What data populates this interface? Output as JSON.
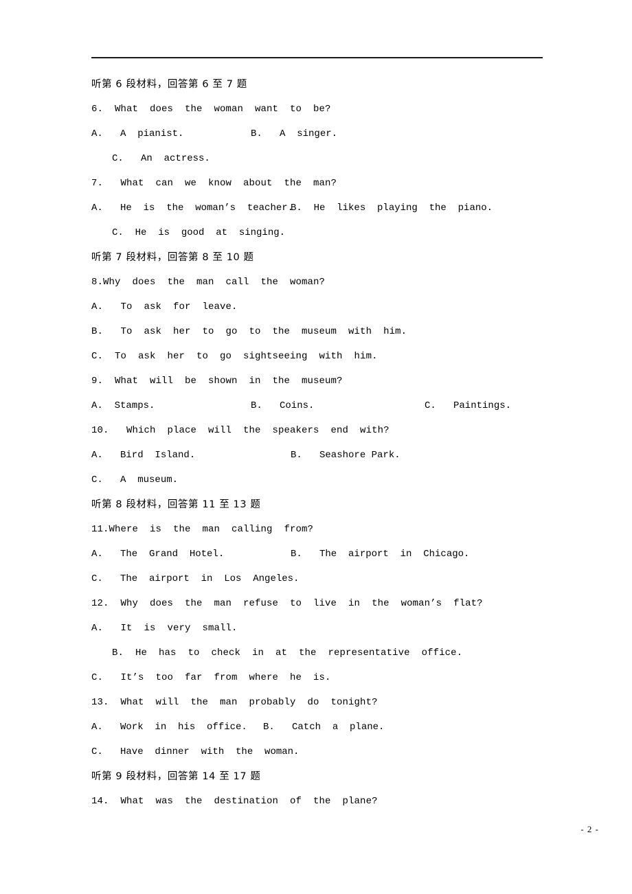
{
  "document": {
    "page_number": "- 2 -"
  },
  "sections": [
    {
      "heading": "听第 6 段材料，回答第 6 至 7 题",
      "questions": [
        {
          "stem": "6.  What  does  the  woman  want  to  be?",
          "row1_a": "A.   A  pianist.",
          "row1_b": "B.   A  singer.",
          "row2_c": "C.   An  actress."
        },
        {
          "stem": "7.   What  can  we  know  about  the  man?",
          "row1_a": "A.   He  is  the  woman’s  teacher.",
          "row1_b": "B.  He  likes  playing  the  piano.",
          "row2_c": "C.  He  is  good  at  singing."
        }
      ]
    },
    {
      "heading": "听第 7 段材料，回答第 8 至 10 题",
      "questions": [
        {
          "stem": "8.Why  does  the  man  call  the  woman?",
          "opt_a": "A.   To  ask  for  leave.",
          "opt_b": "B.   To  ask  her  to  go  to  the  museum  with  him.",
          "opt_c": "C.  To  ask  her  to  go  sightseeing  with  him."
        },
        {
          "stem": "9.  What  will  be  shown  in  the  museum?",
          "row_a": "A.  Stamps.",
          "row_b": "B.   Coins.",
          "row_c": "C.   Paintings."
        },
        {
          "stem": "10.   Which  place  will  the  speakers  end  with?",
          "row1_a": "A.   Bird  Island.",
          "row1_b": "B.   Seashore Park.",
          "row2_c": "C.   A  museum."
        }
      ]
    },
    {
      "heading": "听第 8 段材料，回答第 11 至 13 题",
      "questions": [
        {
          "stem": "11.Where  is  the  man  calling  from?",
          "row1_a": "A.   The  Grand  Hotel.",
          "row1_b": "B.   The  airport  in  Chicago.",
          "row2_c": "C.   The  airport  in  Los  Angeles."
        },
        {
          "stem": "12.  Why  does  the  man  refuse  to  live  in  the  woman’s  flat?",
          "opt_a": "A.   It  is  very  small.",
          "opt_b": "B.  He  has  to  check  in  at  the  representative  office.",
          "opt_c": "C.   It’s  too  far  from  where  he  is."
        },
        {
          "stem": "13.  What  will  the  man  probably  do  tonight?",
          "row1_a": "A.   Work  in  his  office.",
          "row1_b": "B.   Catch  a  plane.",
          "row2_c": "C.   Have  dinner  with  the  woman."
        }
      ]
    },
    {
      "heading": "听第 9 段材料，回答第 14 至 17 题",
      "questions": [
        {
          "stem": "14.  What  was  the  destination  of  the  plane?"
        }
      ]
    }
  ]
}
